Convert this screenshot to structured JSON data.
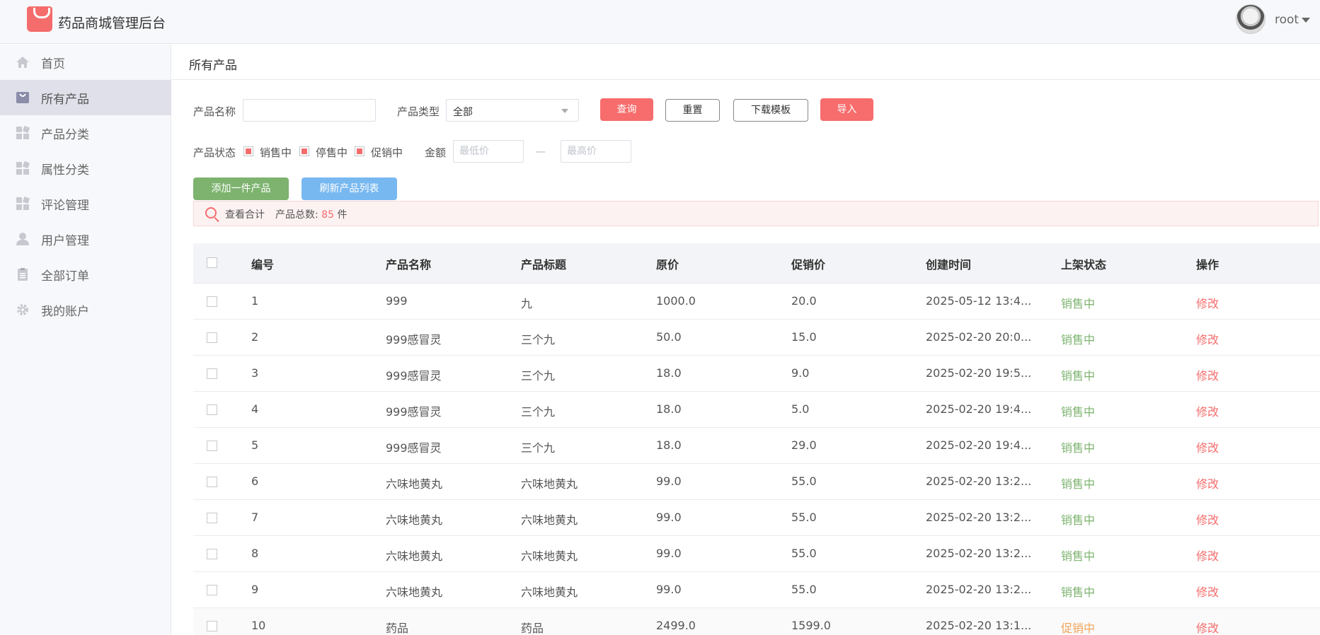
{
  "app": {
    "title": "药品商城管理后台",
    "user": "root",
    "brand_color": "#f56c6c"
  },
  "sidebar": {
    "items": [
      {
        "label": "首页",
        "icon": "home-icon"
      },
      {
        "label": "所有产品",
        "icon": "bag-icon",
        "active": true
      },
      {
        "label": "产品分类",
        "icon": "grid-icon"
      },
      {
        "label": "属性分类",
        "icon": "grid-icon"
      },
      {
        "label": "评论管理",
        "icon": "grid-icon"
      },
      {
        "label": "用户管理",
        "icon": "user-icon"
      },
      {
        "label": "全部订单",
        "icon": "clipboard-icon"
      },
      {
        "label": "我的账户",
        "icon": "gear-icon"
      }
    ]
  },
  "page": {
    "title": "所有产品"
  },
  "filters": {
    "name_label": "产品名称",
    "name_value": "",
    "type_label": "产品类型",
    "type_value": "全部",
    "status_label": "产品状态",
    "status_options": [
      {
        "label": "销售中",
        "checked": true
      },
      {
        "label": "停售中",
        "checked": true
      },
      {
        "label": "促销中",
        "checked": true
      }
    ],
    "amount_label": "金额",
    "min_price_placeholder": "最低价",
    "max_price_placeholder": "最高价",
    "dash": "—"
  },
  "buttons": {
    "search": "查询",
    "reset": "重置",
    "download_template": "下载模板",
    "import": "导入",
    "add_product": "添加一件产品",
    "refresh_list": "刷新产品列表"
  },
  "summary": {
    "view_total": "查看合计",
    "total_label": "产品总数:",
    "total_count": "85",
    "unit": "件"
  },
  "table": {
    "headers": [
      "编号",
      "产品名称",
      "产品标题",
      "原价",
      "促销价",
      "创建时间",
      "上架状态",
      "操作"
    ],
    "rows": [
      {
        "id": "1",
        "name": "999",
        "title": "九",
        "price": "1000.0",
        "promo": "20.0",
        "created": "2025-05-12 13:4...",
        "status": "销售中",
        "status_type": "on",
        "action": "修改"
      },
      {
        "id": "2",
        "name": "999感冒灵",
        "title": "三个九",
        "price": "50.0",
        "promo": "15.0",
        "created": "2025-02-20 20:0...",
        "status": "销售中",
        "status_type": "on",
        "action": "修改"
      },
      {
        "id": "3",
        "name": "999感冒灵",
        "title": "三个九",
        "price": "18.0",
        "promo": "9.0",
        "created": "2025-02-20 19:5...",
        "status": "销售中",
        "status_type": "on",
        "action": "修改"
      },
      {
        "id": "4",
        "name": "999感冒灵",
        "title": "三个九",
        "price": "18.0",
        "promo": "5.0",
        "created": "2025-02-20 19:4...",
        "status": "销售中",
        "status_type": "on",
        "action": "修改"
      },
      {
        "id": "5",
        "name": "999感冒灵",
        "title": "三个九",
        "price": "18.0",
        "promo": "29.0",
        "created": "2025-02-20 19:4...",
        "status": "销售中",
        "status_type": "on",
        "action": "修改"
      },
      {
        "id": "6",
        "name": "六味地黄丸",
        "title": "六味地黄丸",
        "price": "99.0",
        "promo": "55.0",
        "created": "2025-02-20 13:2...",
        "status": "销售中",
        "status_type": "on",
        "action": "修改"
      },
      {
        "id": "7",
        "name": "六味地黄丸",
        "title": "六味地黄丸",
        "price": "99.0",
        "promo": "55.0",
        "created": "2025-02-20 13:2...",
        "status": "销售中",
        "status_type": "on",
        "action": "修改"
      },
      {
        "id": "8",
        "name": "六味地黄丸",
        "title": "六味地黄丸",
        "price": "99.0",
        "promo": "55.0",
        "created": "2025-02-20 13:2...",
        "status": "销售中",
        "status_type": "on",
        "action": "修改"
      },
      {
        "id": "9",
        "name": "六味地黄丸",
        "title": "六味地黄丸",
        "price": "99.0",
        "promo": "55.0",
        "created": "2025-02-20 13:2...",
        "status": "销售中",
        "status_type": "on",
        "action": "修改"
      },
      {
        "id": "10",
        "name": "药品",
        "title": "药品",
        "price": "2499.0",
        "promo": "1599.0",
        "created": "2025-02-20 13:1...",
        "status": "促销中",
        "status_type": "promo",
        "action": "修改"
      }
    ]
  }
}
